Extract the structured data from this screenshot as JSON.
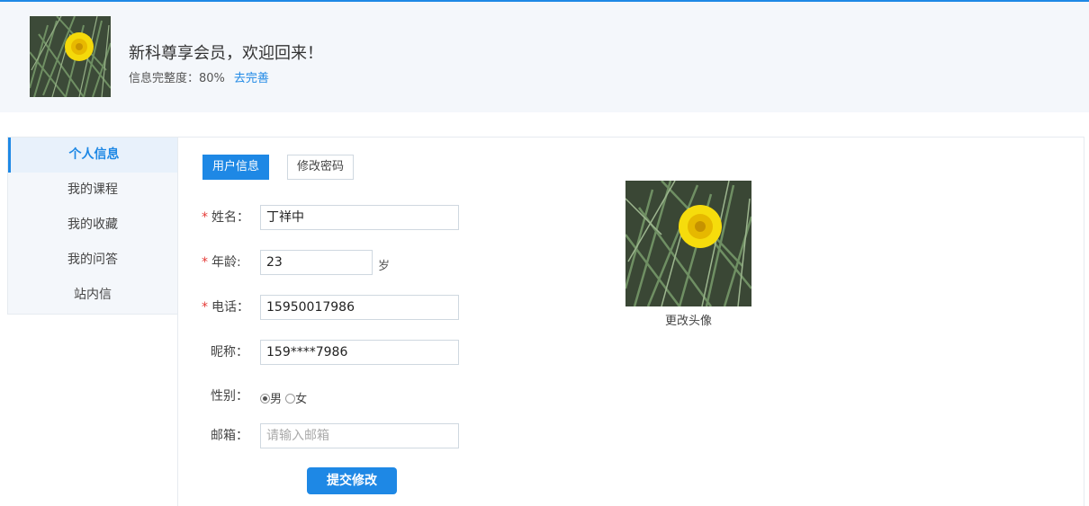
{
  "header": {
    "welcome": "新科尊享会员，欢迎回来！",
    "completeness_label": "信息完整度：80%",
    "complete_link": "去完善"
  },
  "sidebar": {
    "items": [
      {
        "label": "个人信息",
        "active": true
      },
      {
        "label": "我的课程"
      },
      {
        "label": "我的收藏"
      },
      {
        "label": "我的问答"
      },
      {
        "label": "站内信"
      }
    ]
  },
  "tabs": {
    "user_info": "用户信息",
    "change_password": "修改密码"
  },
  "form": {
    "name": {
      "label": "姓名：",
      "value": "丁祥中",
      "required": true
    },
    "age": {
      "label": "年龄:",
      "value": "23",
      "unit": "岁",
      "required": true
    },
    "phone": {
      "label": "电话：",
      "value": "15950017986",
      "required": true
    },
    "nickname": {
      "label": "昵称：",
      "value": "159****7986"
    },
    "gender": {
      "label": "性别：",
      "options": [
        "男",
        "女"
      ],
      "selected": "男"
    },
    "email": {
      "label": "邮箱：",
      "value": "",
      "placeholder": "请输入邮箱"
    },
    "submit_label": "提交修改"
  },
  "avatar": {
    "change_label": "更改头像"
  },
  "colors": {
    "accent": "#1e88e5",
    "required": "#e53935",
    "header_bg": "#f4f7fb"
  }
}
